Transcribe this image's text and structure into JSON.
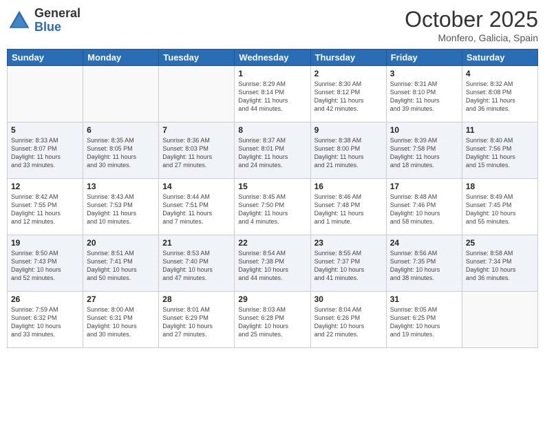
{
  "header": {
    "logo_general": "General",
    "logo_blue": "Blue",
    "month_title": "October 2025",
    "location": "Monfero, Galicia, Spain"
  },
  "days_of_week": [
    "Sunday",
    "Monday",
    "Tuesday",
    "Wednesday",
    "Thursday",
    "Friday",
    "Saturday"
  ],
  "weeks": [
    [
      {
        "day": "",
        "info": ""
      },
      {
        "day": "",
        "info": ""
      },
      {
        "day": "",
        "info": ""
      },
      {
        "day": "1",
        "info": "Sunrise: 8:29 AM\nSunset: 8:14 PM\nDaylight: 11 hours\nand 44 minutes."
      },
      {
        "day": "2",
        "info": "Sunrise: 8:30 AM\nSunset: 8:12 PM\nDaylight: 11 hours\nand 42 minutes."
      },
      {
        "day": "3",
        "info": "Sunrise: 8:31 AM\nSunset: 8:10 PM\nDaylight: 11 hours\nand 39 minutes."
      },
      {
        "day": "4",
        "info": "Sunrise: 8:32 AM\nSunset: 8:08 PM\nDaylight: 11 hours\nand 36 minutes."
      }
    ],
    [
      {
        "day": "5",
        "info": "Sunrise: 8:33 AM\nSunset: 8:07 PM\nDaylight: 11 hours\nand 33 minutes."
      },
      {
        "day": "6",
        "info": "Sunrise: 8:35 AM\nSunset: 8:05 PM\nDaylight: 11 hours\nand 30 minutes."
      },
      {
        "day": "7",
        "info": "Sunrise: 8:36 AM\nSunset: 8:03 PM\nDaylight: 11 hours\nand 27 minutes."
      },
      {
        "day": "8",
        "info": "Sunrise: 8:37 AM\nSunset: 8:01 PM\nDaylight: 11 hours\nand 24 minutes."
      },
      {
        "day": "9",
        "info": "Sunrise: 8:38 AM\nSunset: 8:00 PM\nDaylight: 11 hours\nand 21 minutes."
      },
      {
        "day": "10",
        "info": "Sunrise: 8:39 AM\nSunset: 7:58 PM\nDaylight: 11 hours\nand 18 minutes."
      },
      {
        "day": "11",
        "info": "Sunrise: 8:40 AM\nSunset: 7:56 PM\nDaylight: 11 hours\nand 15 minutes."
      }
    ],
    [
      {
        "day": "12",
        "info": "Sunrise: 8:42 AM\nSunset: 7:55 PM\nDaylight: 11 hours\nand 12 minutes."
      },
      {
        "day": "13",
        "info": "Sunrise: 8:43 AM\nSunset: 7:53 PM\nDaylight: 11 hours\nand 10 minutes."
      },
      {
        "day": "14",
        "info": "Sunrise: 8:44 AM\nSunset: 7:51 PM\nDaylight: 11 hours\nand 7 minutes."
      },
      {
        "day": "15",
        "info": "Sunrise: 8:45 AM\nSunset: 7:50 PM\nDaylight: 11 hours\nand 4 minutes."
      },
      {
        "day": "16",
        "info": "Sunrise: 8:46 AM\nSunset: 7:48 PM\nDaylight: 11 hours\nand 1 minute."
      },
      {
        "day": "17",
        "info": "Sunrise: 8:48 AM\nSunset: 7:46 PM\nDaylight: 10 hours\nand 58 minutes."
      },
      {
        "day": "18",
        "info": "Sunrise: 8:49 AM\nSunset: 7:45 PM\nDaylight: 10 hours\nand 55 minutes."
      }
    ],
    [
      {
        "day": "19",
        "info": "Sunrise: 8:50 AM\nSunset: 7:43 PM\nDaylight: 10 hours\nand 52 minutes."
      },
      {
        "day": "20",
        "info": "Sunrise: 8:51 AM\nSunset: 7:41 PM\nDaylight: 10 hours\nand 50 minutes."
      },
      {
        "day": "21",
        "info": "Sunrise: 8:53 AM\nSunset: 7:40 PM\nDaylight: 10 hours\nand 47 minutes."
      },
      {
        "day": "22",
        "info": "Sunrise: 8:54 AM\nSunset: 7:38 PM\nDaylight: 10 hours\nand 44 minutes."
      },
      {
        "day": "23",
        "info": "Sunrise: 8:55 AM\nSunset: 7:37 PM\nDaylight: 10 hours\nand 41 minutes."
      },
      {
        "day": "24",
        "info": "Sunrise: 8:56 AM\nSunset: 7:35 PM\nDaylight: 10 hours\nand 38 minutes."
      },
      {
        "day": "25",
        "info": "Sunrise: 8:58 AM\nSunset: 7:34 PM\nDaylight: 10 hours\nand 36 minutes."
      }
    ],
    [
      {
        "day": "26",
        "info": "Sunrise: 7:59 AM\nSunset: 6:32 PM\nDaylight: 10 hours\nand 33 minutes."
      },
      {
        "day": "27",
        "info": "Sunrise: 8:00 AM\nSunset: 6:31 PM\nDaylight: 10 hours\nand 30 minutes."
      },
      {
        "day": "28",
        "info": "Sunrise: 8:01 AM\nSunset: 6:29 PM\nDaylight: 10 hours\nand 27 minutes."
      },
      {
        "day": "29",
        "info": "Sunrise: 8:03 AM\nSunset: 6:28 PM\nDaylight: 10 hours\nand 25 minutes."
      },
      {
        "day": "30",
        "info": "Sunrise: 8:04 AM\nSunset: 6:26 PM\nDaylight: 10 hours\nand 22 minutes."
      },
      {
        "day": "31",
        "info": "Sunrise: 8:05 AM\nSunset: 6:25 PM\nDaylight: 10 hours\nand 19 minutes."
      },
      {
        "day": "",
        "info": ""
      }
    ]
  ]
}
